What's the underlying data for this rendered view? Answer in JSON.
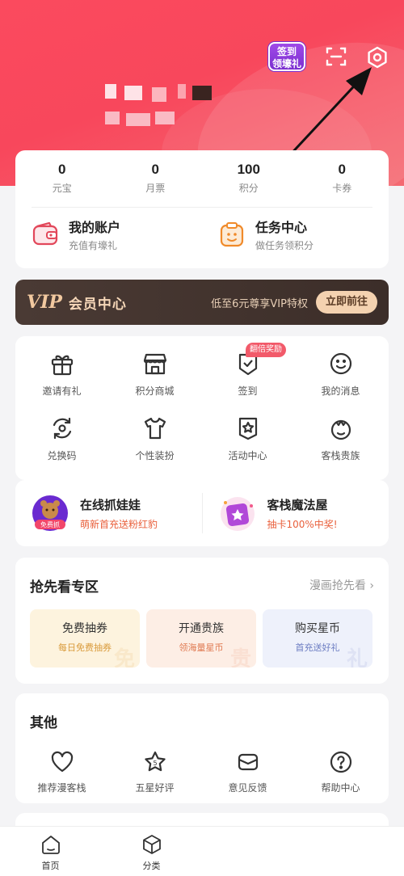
{
  "header": {
    "checkin_line1": "签到",
    "checkin_line2": "领壕礼"
  },
  "stats": [
    {
      "value": "0",
      "label": "元宝"
    },
    {
      "value": "0",
      "label": "月票"
    },
    {
      "value": "100",
      "label": "积分"
    },
    {
      "value": "0",
      "label": "卡券"
    }
  ],
  "accounts": [
    {
      "title": "我的账户",
      "subtitle": "充值有壕礼"
    },
    {
      "title": "任务中心",
      "subtitle": "做任务领积分"
    }
  ],
  "vip": {
    "logo": "VIP",
    "title": "会员中心",
    "desc": "低至6元尊享VIP特权",
    "button": "立即前往"
  },
  "grid": {
    "items": [
      {
        "label": "邀请有礼"
      },
      {
        "label": "积分商城"
      },
      {
        "label": "签到"
      },
      {
        "label": "我的消息"
      },
      {
        "label": "兑换码"
      },
      {
        "label": "个性装扮"
      },
      {
        "label": "活动中心"
      },
      {
        "label": "客栈贵族"
      }
    ],
    "checkin_tag": "翻倍奖励"
  },
  "promos": [
    {
      "title": "在线抓娃娃",
      "subtitle": "萌新首充送粉红豹",
      "badge": "免费抓"
    },
    {
      "title": "客栈魔法屋",
      "subtitle": "抽卡100%中奖!"
    }
  ],
  "preview": {
    "title": "抢先看专区",
    "more": "漫画抢先看",
    "cards": [
      {
        "title": "免费抽券",
        "subtitle": "每日免费抽券",
        "watermark": "免",
        "color": "#fdf3de",
        "sub_color": "#d99b3c"
      },
      {
        "title": "开通贵族",
        "subtitle": "领海量星币",
        "watermark": "贵",
        "color": "#fdeee5",
        "sub_color": "#e07a52"
      },
      {
        "title": "购买星币",
        "subtitle": "首充送好礼",
        "watermark": "礼",
        "color": "#eef1fb",
        "sub_color": "#6b7cc2"
      }
    ]
  },
  "other": {
    "title": "其他",
    "items": [
      {
        "label": "推荐漫客栈"
      },
      {
        "label": "五星好评"
      },
      {
        "label": "意见反馈"
      },
      {
        "label": "帮助中心"
      }
    ]
  },
  "tabbar": [
    {
      "label": "首页"
    },
    {
      "label": "分类"
    }
  ],
  "colors": {
    "header": "#f8475c",
    "accent": "#f25a6a",
    "icon": "#333333",
    "vip_bg": "#3c2e29"
  }
}
